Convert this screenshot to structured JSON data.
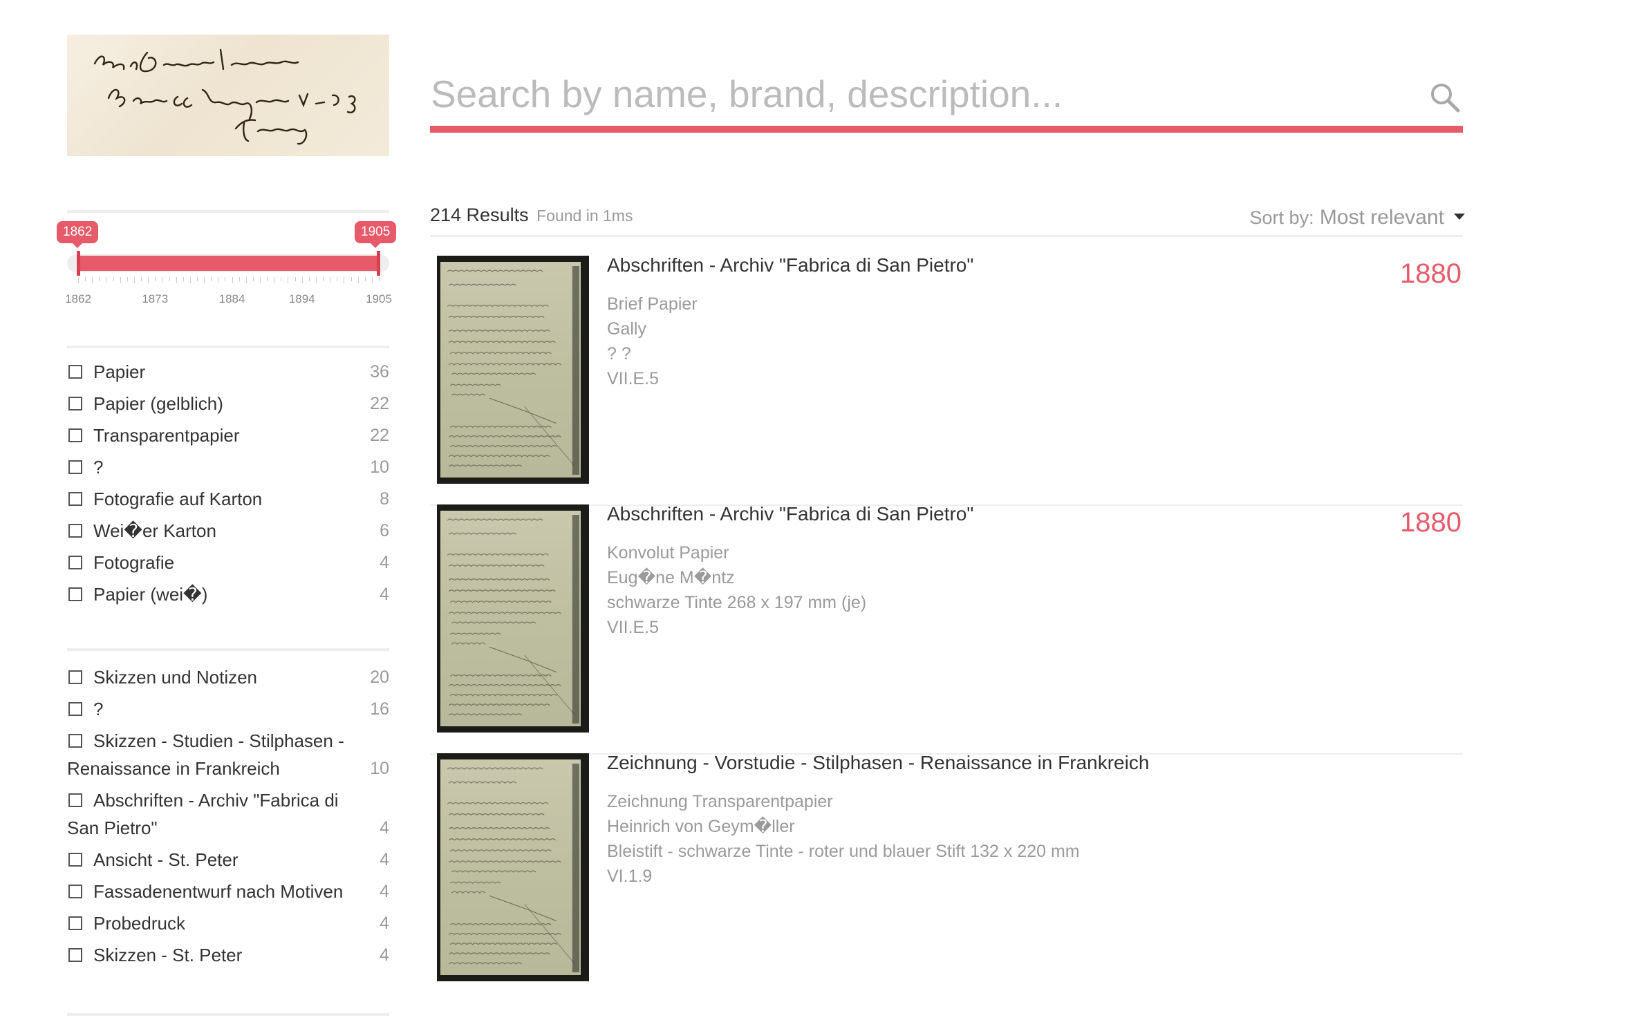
{
  "logo": {
    "handwriting_lines": [
      "Enrico di Geymuller architetto",
      "Borgo SS. Appostoli N° 5. 3°",
      "Firenze"
    ]
  },
  "search": {
    "placeholder": "Search by name, brand, description...",
    "value": "",
    "icon": "search-icon",
    "accent_color": "#e65a69"
  },
  "year_range": {
    "min": 1862,
    "max": 1905,
    "selected_from": "1862",
    "selected_to": "1905",
    "tick_labels": [
      "1862",
      "1873",
      "1884",
      "1894",
      "1905"
    ]
  },
  "facets": {
    "material": [
      {
        "label": "Papier",
        "count": "36"
      },
      {
        "label": "Papier (gelblich)",
        "count": "22"
      },
      {
        "label": "Transparentpapier",
        "count": "22"
      },
      {
        "label": "?",
        "count": "10"
      },
      {
        "label": "Fotografie auf Karton",
        "count": "8"
      },
      {
        "label": "Wei�er Karton",
        "count": "6"
      },
      {
        "label": "Fotografie",
        "count": "4"
      },
      {
        "label": "Papier (wei�)",
        "count": "4"
      }
    ],
    "category": [
      {
        "label": "Skizzen und Notizen",
        "count": "20"
      },
      {
        "label": "?",
        "count": "16"
      },
      {
        "label": "Skizzen - Studien - Stilphasen - Renaissance in Frankreich",
        "count": "10"
      },
      {
        "label": "Abschriften - Archiv \"Fabrica di San Pietro\"",
        "count": "4"
      },
      {
        "label": "Ansicht - St. Peter",
        "count": "4"
      },
      {
        "label": "Fassadenentwurf nach Motiven",
        "count": "4"
      },
      {
        "label": "Probedruck",
        "count": "4"
      },
      {
        "label": "Skizzen - St. Peter",
        "count": "4"
      }
    ]
  },
  "results_header": {
    "count_text": "214 Results",
    "time_text": "Found in 1ms",
    "sort_prefix": "Sort by:",
    "sort_value": "Most relevant"
  },
  "results": [
    {
      "title": "Abschriften - Archiv \"Fabrica di San Pietro\"",
      "year": "1880",
      "meta": [
        "Brief Papier",
        "Gally",
        "? ?",
        "VII.E.5"
      ]
    },
    {
      "title": "Abschriften - Archiv \"Fabrica di San Pietro\"",
      "year": "1880",
      "meta": [
        "Konvolut Papier",
        "Eug�ne M�ntz",
        "schwarze Tinte 268 x 197 mm (je)",
        "VII.E.5"
      ]
    },
    {
      "title": "Zeichnung - Vorstudie - Stilphasen - Renaissance in Frankreich",
      "year": "",
      "meta": [
        "Zeichnung Transparentpapier",
        "Heinrich von Geym�ller",
        "Bleistift - schwarze Tinte - roter und blauer Stift 132 x 220 mm",
        "VI.1.9"
      ]
    }
  ]
}
